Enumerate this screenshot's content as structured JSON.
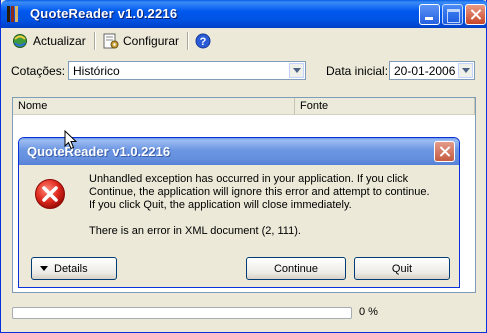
{
  "window": {
    "title": "QuoteReader v1.0.2216"
  },
  "toolbar": {
    "refresh_label": "Actualizar",
    "configure_label": "Configurar",
    "help_icon": "help-icon"
  },
  "filters": {
    "quotes_label": "Cotações:",
    "quotes_value": "Histórico",
    "start_date_label": "Data inicial:",
    "start_date_value": "20-01-2006"
  },
  "list": {
    "columns": [
      "Nome",
      "Fonte"
    ]
  },
  "status": {
    "progress_text": "0 %",
    "progress_fraction": 0.0
  },
  "dialog": {
    "title": "QuoteReader v1.0.2216",
    "message_line1": "Unhandled exception has occurred in your application. If you click",
    "message_line2": "Continue, the application will ignore this error and attempt to continue.",
    "message_line3": "If you click Quit, the application will close immediately.",
    "error_detail": "There is an error in XML document (2, 111).",
    "details_label": "Details",
    "continue_label": "Continue",
    "quit_label": "Quit"
  },
  "colors": {
    "titlebar": "#0058EE",
    "dialog_titlebar": "#6C96E2",
    "error_red": "#D81E1E"
  }
}
